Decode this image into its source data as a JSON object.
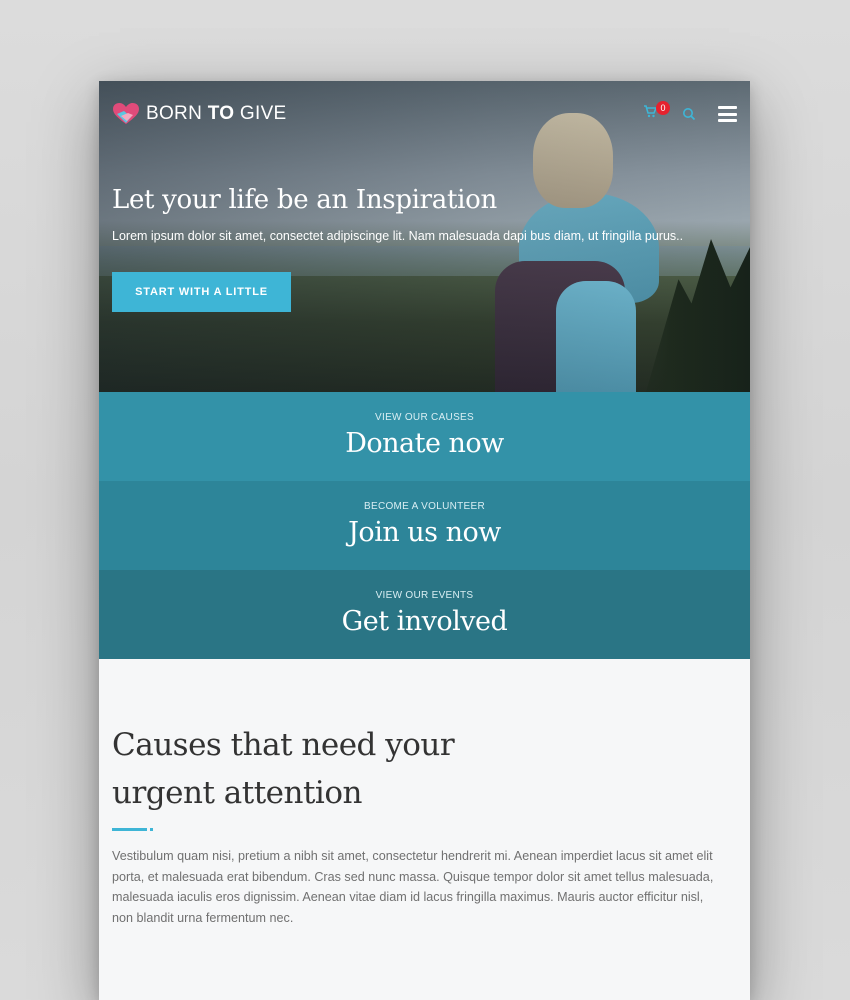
{
  "brand": {
    "name_part1": "BORN ",
    "name_part2": "TO",
    "name_part3": " GIVE"
  },
  "nav": {
    "cart_count": "0",
    "icons": [
      "cart-icon",
      "search-icon",
      "hamburger-menu-icon"
    ]
  },
  "hero": {
    "title": "Let your life be an Inspiration",
    "subtitle": "Lorem ipsum dolor sit amet, consectet adipiscinge lit. Nam malesuada dapi bus diam, ut fringilla purus..",
    "button_label": "START WITH A LITTLE"
  },
  "bands": [
    {
      "eyebrow": "VIEW OUR CAUSES",
      "headline": "Donate now"
    },
    {
      "eyebrow": "BECOME A VOLUNTEER",
      "headline": "Join us now"
    },
    {
      "eyebrow": "VIEW OUR EVENTS",
      "headline": "Get involved"
    }
  ],
  "causes": {
    "title_line1": "Causes that need your",
    "title_line2": "urgent attention",
    "body": "Vestibulum quam nisi, pretium a nibh sit amet, consectetur hendrerit mi. Aenean imperdiet lacus sit amet elit porta, et malesuada erat bibendum. Cras sed nunc massa. Quisque tempor dolor sit amet tellus malesuada, malesuada iaculis eros dignissim. Aenean vitae diam id lacus fringilla maximus. Mauris auctor efficitur nisl, non blandit urna fermentum nec."
  },
  "colors": {
    "accent": "#3eb5d6",
    "band1": "#3392a8",
    "band2": "#2d8599",
    "band3": "#2a7585",
    "badge": "#e6222e"
  }
}
